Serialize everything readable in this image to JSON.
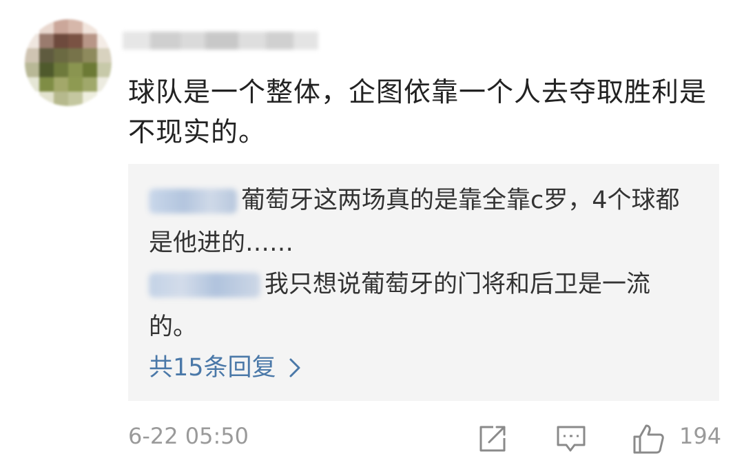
{
  "comment": {
    "text": "球队是一个整体，企图依靠一个人去夺取胜利是不现实的。",
    "timestamp": "6-22 05:50",
    "like_count": "194"
  },
  "replies": [
    {
      "text": "葡萄牙这两场真的是靠全靠c罗，4个球都是他进的……"
    },
    {
      "text": "我只想说葡萄牙的门将和后卫是一流的。"
    }
  ],
  "more_replies_label": "共15条回复",
  "icons": {
    "share": "share-icon",
    "comment": "comment-icon",
    "like": "thumbs-up-icon",
    "more": "chevron-right-icon"
  },
  "colors": {
    "text": "#222222",
    "link": "#4a78a8",
    "muted": "#9a9a9a",
    "reply_bg": "#f4f4f4"
  }
}
